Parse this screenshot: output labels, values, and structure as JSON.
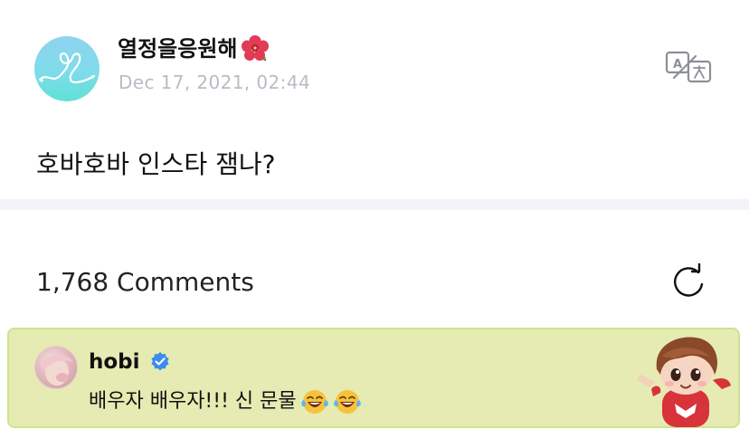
{
  "post": {
    "author": "열정을응원해",
    "author_flower_icon": "hibiscus-emoji",
    "timestamp": "Dec 17, 2021, 02:44",
    "body": "호바호바 인스타 잼나?",
    "translate_icon": "translate-icon"
  },
  "comments": {
    "count_label": "1,768 Comments",
    "refresh_icon": "refresh-icon",
    "pinned": {
      "author": "hobi",
      "verified_icon": "verified-badge-icon",
      "text": "배우자 배우자!!! 신 문물",
      "emoji": [
        "tears-of-joy-emoji",
        "tears-of-joy-emoji"
      ],
      "highlight_color": "#e5ebb2",
      "border_color": "#cfe38c"
    }
  }
}
